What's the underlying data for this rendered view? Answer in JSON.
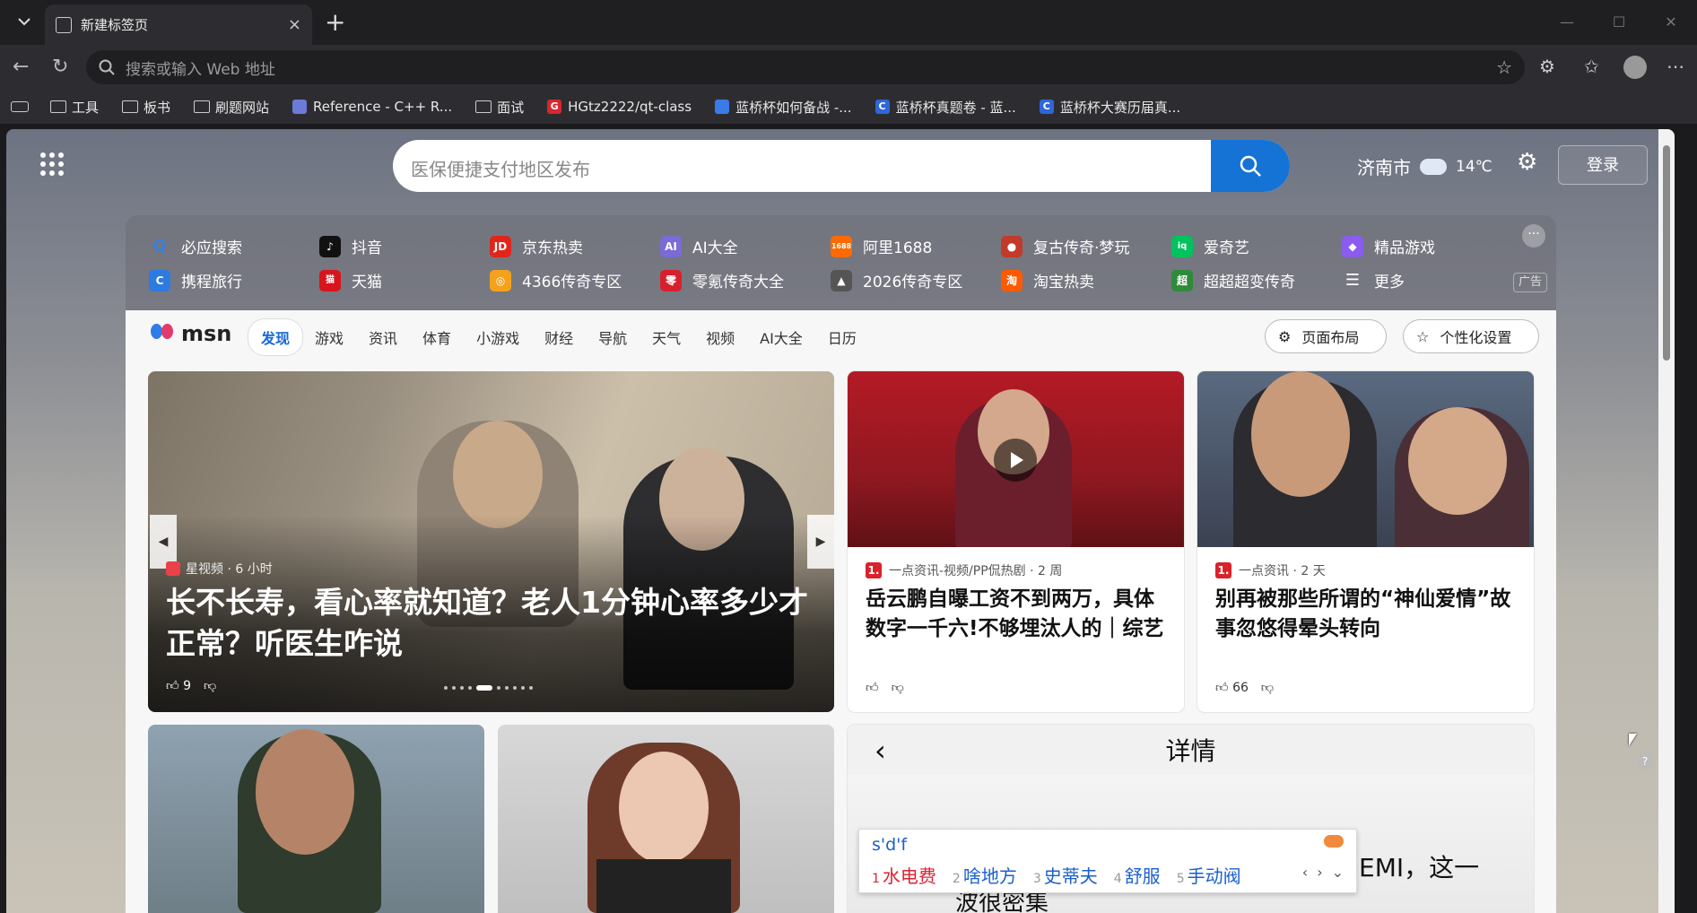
{
  "browser": {
    "tab_title": "新建标签页",
    "tab_close": "×",
    "new_tab": "+",
    "window_controls": [
      "—",
      "☐",
      "✕"
    ],
    "address_placeholder": "搜索或输入 Web 地址",
    "bookmarks": [
      {
        "label": "工具",
        "type": "folder"
      },
      {
        "label": "板书",
        "type": "folder"
      },
      {
        "label": "刷题网站",
        "type": "folder"
      },
      {
        "label": "Reference - C++ R...",
        "type": "site",
        "color": "#6b7bd6",
        "glyph": ""
      },
      {
        "label": "面试",
        "type": "folder"
      },
      {
        "label": "HGtz2222/qt-class",
        "type": "site",
        "color": "#d8262e",
        "glyph": "G"
      },
      {
        "label": "蓝桥杯如何备战 -...",
        "type": "site",
        "color": "#3b7be8",
        "glyph": ""
      },
      {
        "label": "蓝桥杯真题卷 - 蓝...",
        "type": "site",
        "color": "#2f66d9",
        "glyph": "C"
      },
      {
        "label": "蓝桥杯大赛历届真...",
        "type": "site",
        "color": "#2f66d9",
        "glyph": "C"
      }
    ]
  },
  "newtab": {
    "search_query": "医保便捷支付地区发布",
    "city": "济南市",
    "temperature": "14℃",
    "login_label": "登录",
    "quick_links": [
      {
        "label": "必应搜索",
        "color": "#3a7fd8",
        "glyph": "Q"
      },
      {
        "label": "抖音",
        "color": "#111111",
        "glyph": "♪"
      },
      {
        "label": "京东热卖",
        "color": "#e1251b",
        "glyph": "JD"
      },
      {
        "label": "AI大全",
        "color": "#7b6ad8",
        "glyph": "AI"
      },
      {
        "label": "阿里1688",
        "color": "#ff6a00",
        "glyph": "1688"
      },
      {
        "label": "复古传奇·梦玩",
        "color": "#c23a2a",
        "glyph": "●"
      },
      {
        "label": "爱奇艺",
        "color": "#00c25f",
        "glyph": "iq"
      },
      {
        "label": "精品游戏",
        "color": "#8a5cf0",
        "glyph": "◆"
      },
      {
        "label": "携程旅行",
        "color": "#2d7be0",
        "glyph": "C"
      },
      {
        "label": "天猫",
        "color": "#d8141c",
        "glyph": "猫"
      },
      {
        "label": "4366传奇专区",
        "color": "#f4a21c",
        "glyph": "◎"
      },
      {
        "label": "零氪传奇大全",
        "color": "#d8202c",
        "glyph": "零"
      },
      {
        "label": "2026传奇专区",
        "color": "#555555",
        "glyph": "▲"
      },
      {
        "label": "淘宝热卖",
        "color": "#ff5a00",
        "glyph": "淘"
      },
      {
        "label": "超超超变传奇",
        "color": "#2e8b3a",
        "glyph": "超"
      },
      {
        "label": "更多",
        "color": "transparent",
        "glyph": "☰"
      }
    ],
    "ad_label": "广告",
    "more_dots": "···"
  },
  "msn": {
    "logo_text": "msn",
    "tabs": [
      "发现",
      "游戏",
      "资讯",
      "体育",
      "小游戏",
      "财经",
      "导航",
      "天气",
      "视频",
      "AI大全",
      "日历"
    ],
    "active_tab": "发现",
    "layout_button": "页面布局",
    "personalize_button": "个性化设置",
    "hero": {
      "source": "星视频 · 6 小时",
      "title": "长不长寿，看心率就知道？老人1分钟心率多少才正常？听医生咋说",
      "likes": "9"
    },
    "cards": [
      {
        "source": "一点资讯-视频/PP侃热剧 · 2 周",
        "source_badge": "1.",
        "title": "岳云鹏自曝工资不到两万，具体数字一千六!不够埋汰人的｜综艺",
        "likes": ""
      },
      {
        "source": "一点资讯 · 2 天",
        "source_badge": "1.",
        "title": "别再被那些所谓的“神仙爱情”故事忽悠得晕头转向",
        "likes": "66"
      }
    ],
    "detail": {
      "title": "详情",
      "fragment1": "EMI，这一",
      "fragment2": "波很密集"
    }
  },
  "ime": {
    "composition": "s'd'f",
    "candidates": [
      "水电费",
      "啥地方",
      "史蒂夫",
      "舒服",
      "手动阀"
    ]
  }
}
